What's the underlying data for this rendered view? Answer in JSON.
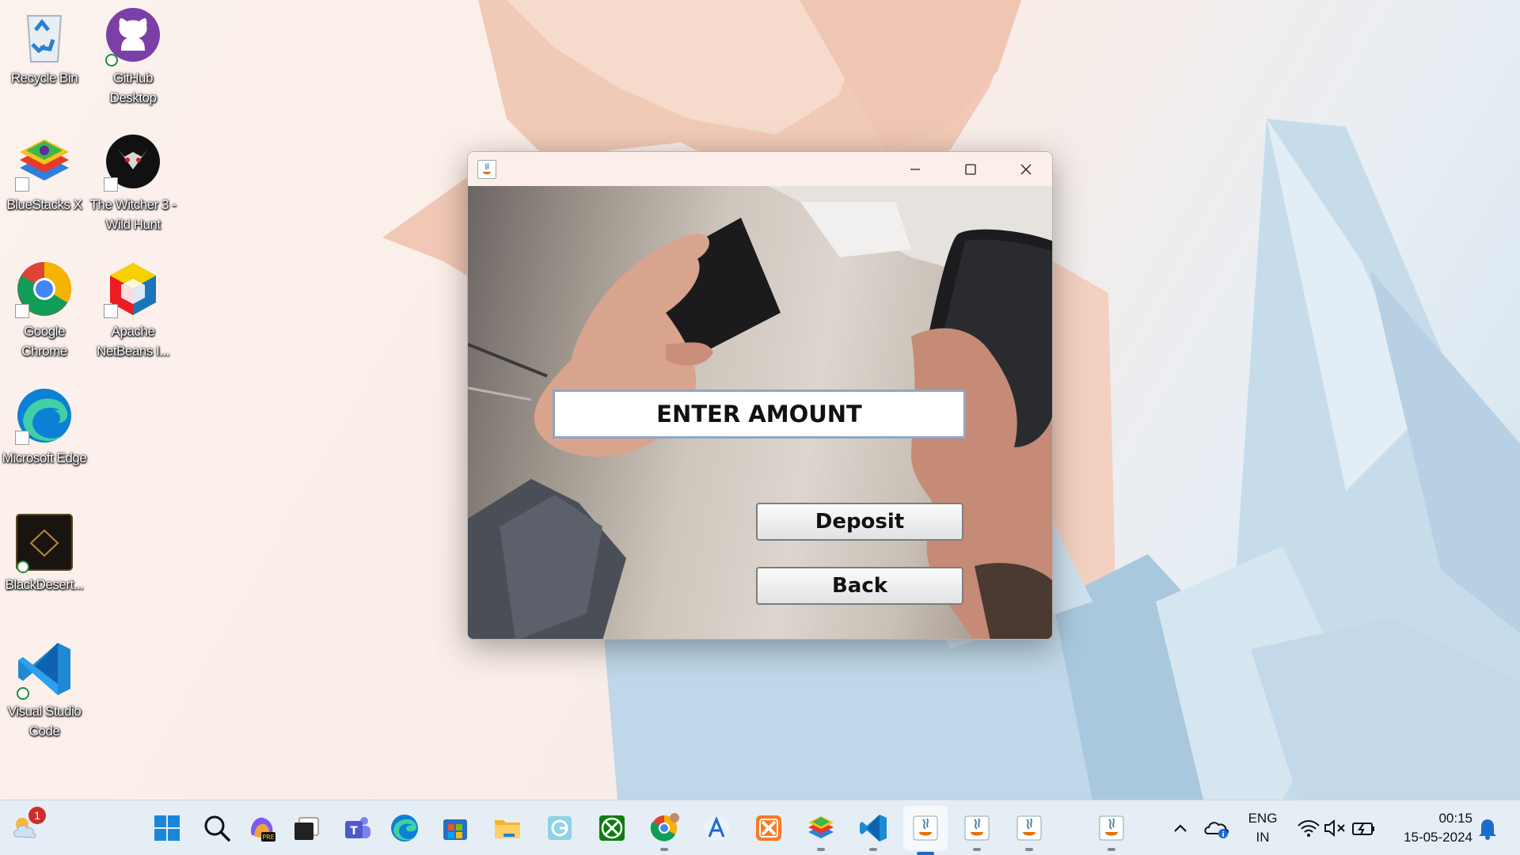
{
  "desktop": {
    "icons": [
      {
        "label": "Recycle Bin"
      },
      {
        "label": "GitHub Desktop"
      },
      {
        "label": "BlueStacks X"
      },
      {
        "label": "The Witcher 3 - Wild Hunt"
      },
      {
        "label": "Google Chrome"
      },
      {
        "label": "Apache NetBeans I..."
      },
      {
        "label": "Microsoft Edge"
      },
      {
        "label": "BlackDesert..."
      },
      {
        "label": "Visual Studio Code"
      }
    ]
  },
  "window": {
    "title": "",
    "amount_field": {
      "placeholder": "ENTER AMOUNT"
    },
    "deposit_label": "Deposit",
    "back_label": "Back"
  },
  "taskbar": {
    "weather_badge": "1",
    "apps": [
      "start",
      "search",
      "copilot",
      "task-view",
      "teams",
      "edge",
      "store",
      "file-explorer",
      "outlook",
      "xbox",
      "chrome",
      "translator",
      "xampp",
      "bluestacks",
      "vscode",
      "java-app-1",
      "java-app-2",
      "java-app-3",
      "java-app-4"
    ],
    "language": "ENG",
    "region": "IN",
    "time": "00:15",
    "date": "15-05-2024"
  },
  "colors": {
    "accent": "#1b6ac9",
    "field_border": "#8fa6c8"
  }
}
